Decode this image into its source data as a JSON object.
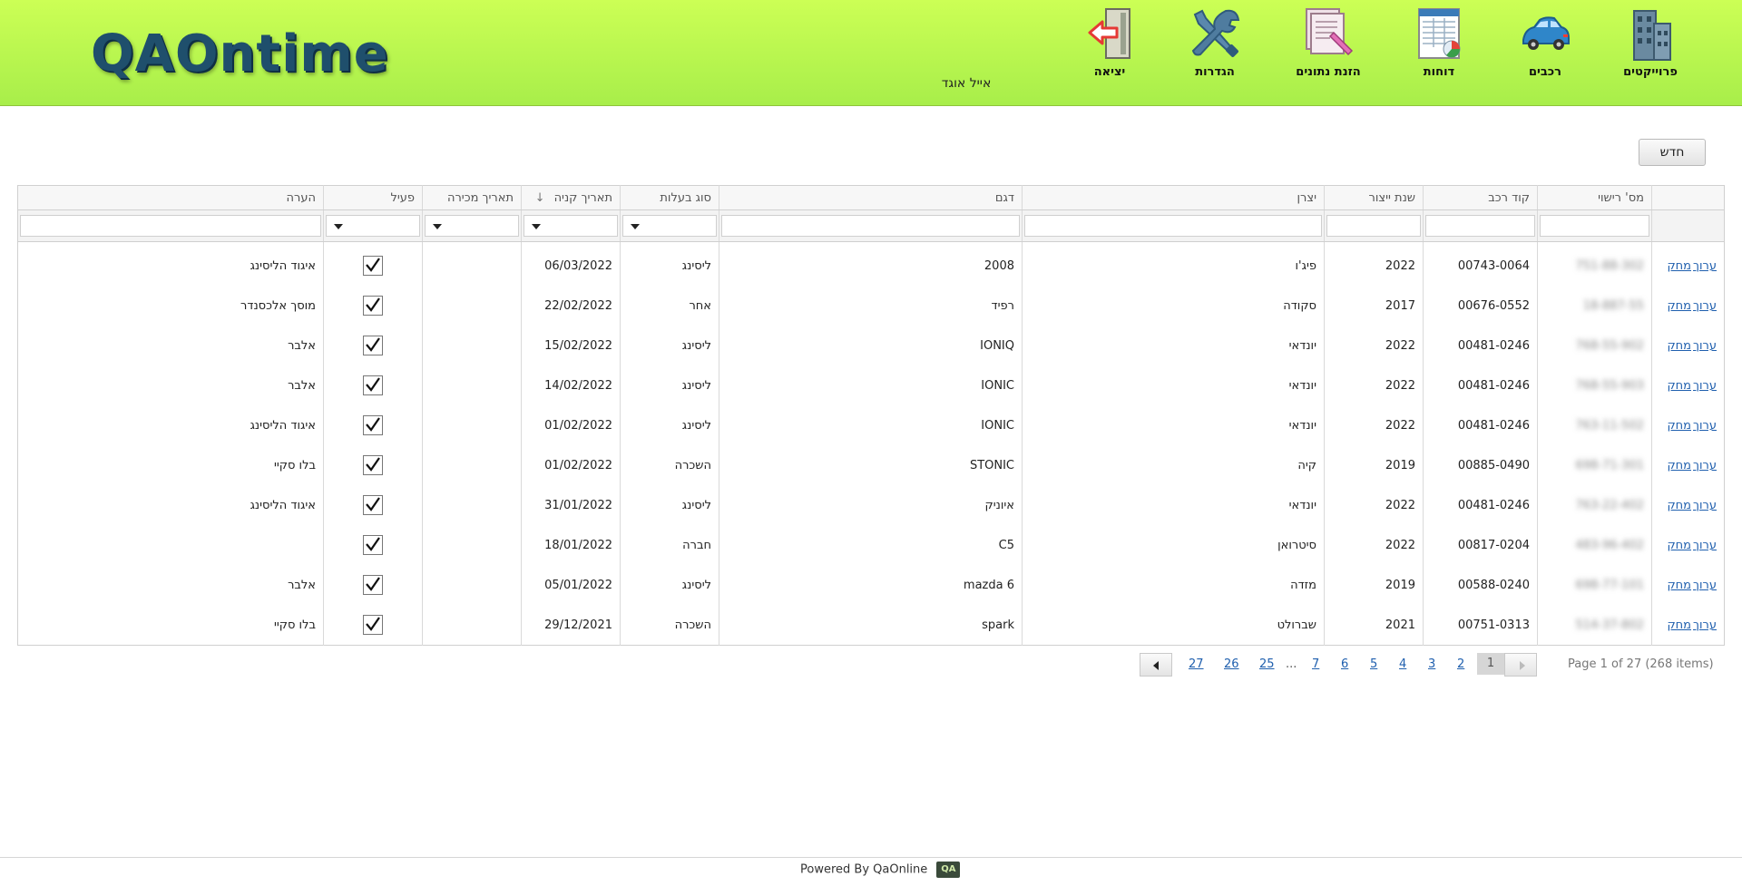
{
  "header": {
    "logo_text": "QAOntime",
    "user_name": "אייל אוגד",
    "nav": [
      {
        "label": "פרוייקטים",
        "icon": "building-icon"
      },
      {
        "label": "רכבים",
        "icon": "car-icon"
      },
      {
        "label": "דוחות",
        "icon": "report-icon"
      },
      {
        "label": "הזנת נתונים",
        "icon": "data-entry-icon"
      },
      {
        "label": "הגדרות",
        "icon": "settings-tools-icon"
      },
      {
        "label": "יציאה",
        "icon": "exit-icon"
      }
    ]
  },
  "toolbar": {
    "new_label": "חדש"
  },
  "grid": {
    "columns": {
      "plate": "מס' רישוי",
      "code": "קוד רכב",
      "year": "שנת ייצור",
      "maker": "יצרן",
      "model": "דגם",
      "ownership": "סוג בעלות",
      "purchase": "תאריך קניה",
      "sale": "תאריך מכירה",
      "active": "פעיל",
      "note": "הערה"
    },
    "sort_icon": "↓",
    "row_links": {
      "delete": "מחק",
      "edit": "ערוך"
    },
    "rows": [
      {
        "plate": "751-88-302",
        "code": "00743-0064",
        "year": "2022",
        "maker": "פיג'ו",
        "model": "2008",
        "ownership": "ליסינג",
        "purchase": "06/03/2022",
        "sale": "",
        "active": true,
        "note": "איגוד הליסינג"
      },
      {
        "plate": "18-887-55",
        "code": "00676-0552",
        "year": "2017",
        "maker": "סקודה",
        "model": "רפיד",
        "ownership": "אחר",
        "purchase": "22/02/2022",
        "sale": "",
        "active": true,
        "note": "מוסך אלכסנדר"
      },
      {
        "plate": "768-55-902",
        "code": "00481-0246",
        "year": "2022",
        "maker": "יונדאי",
        "model": "IONIQ",
        "ownership": "ליסינג",
        "purchase": "15/02/2022",
        "sale": "",
        "active": true,
        "note": "אלבר"
      },
      {
        "plate": "768-55-903",
        "code": "00481-0246",
        "year": "2022",
        "maker": "יונדאי",
        "model": "IONIC",
        "ownership": "ליסינג",
        "purchase": "14/02/2022",
        "sale": "",
        "active": true,
        "note": "אלבר"
      },
      {
        "plate": "763-11-502",
        "code": "00481-0246",
        "year": "2022",
        "maker": "יונדאי",
        "model": "IONIC",
        "ownership": "ליסינג",
        "purchase": "01/02/2022",
        "sale": "",
        "active": true,
        "note": "איגוד הליסינג"
      },
      {
        "plate": "698-71-301",
        "code": "00885-0490",
        "year": "2019",
        "maker": "קיה",
        "model": "STONIC",
        "ownership": "השכרה",
        "purchase": "01/02/2022",
        "sale": "",
        "active": true,
        "note": "בלו סקיי"
      },
      {
        "plate": "763-22-402",
        "code": "00481-0246",
        "year": "2022",
        "maker": "יונדאי",
        "model": "איוניק",
        "ownership": "ליסינג",
        "purchase": "31/01/2022",
        "sale": "",
        "active": true,
        "note": "איגוד הליסינג"
      },
      {
        "plate": "483-96-402",
        "code": "00817-0204",
        "year": "2022",
        "maker": "סיטרואן",
        "model": "C5",
        "ownership": "חברה",
        "purchase": "18/01/2022",
        "sale": "",
        "active": true,
        "note": ""
      },
      {
        "plate": "698-77-101",
        "code": "00588-0240",
        "year": "2019",
        "maker": "מזדה",
        "model": "mazda 6",
        "ownership": "ליסינג",
        "purchase": "05/01/2022",
        "sale": "",
        "active": true,
        "note": "אלבר"
      },
      {
        "plate": "514-37-802",
        "code": "00751-0313",
        "year": "2021",
        "maker": "שברולט",
        "model": "spark",
        "ownership": "השכרה",
        "purchase": "29/12/2021",
        "sale": "",
        "active": true,
        "note": "בלו סקיי"
      }
    ]
  },
  "pager": {
    "current": "1",
    "pages": [
      "2",
      "3",
      "4",
      "5",
      "6",
      "7",
      "...",
      "25",
      "26",
      "27"
    ],
    "info": "Page 1 of 27 (268 items)"
  },
  "footer": {
    "text": "Powered By QaOnline",
    "logo_text": "QA"
  },
  "colors": {
    "header_top": "#ccff55",
    "header_bottom": "#a8ee4a",
    "link": "#1f5fae"
  }
}
